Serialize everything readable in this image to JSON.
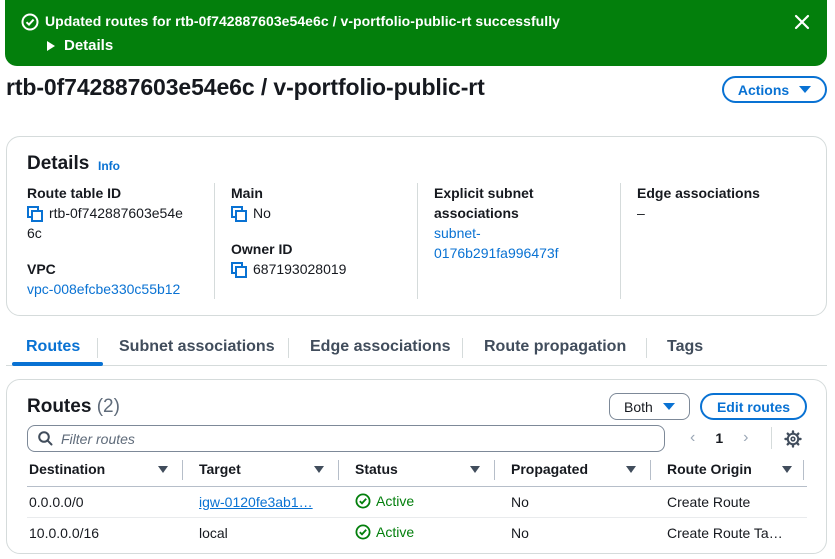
{
  "flash": {
    "message": "Updated routes for rtb-0f742887603e54e6c / v-portfolio-public-rt successfully",
    "details_label": "Details"
  },
  "header": {
    "title": "rtb-0f742887603e54e6c / v-portfolio-public-rt",
    "actions_label": "Actions"
  },
  "details": {
    "heading": "Details",
    "info_label": "Info",
    "route_table_id_label": "Route table ID",
    "route_table_id_line1": "rtb-0f742887603e54e",
    "route_table_id_line2": "6c",
    "vpc_label": "VPC",
    "vpc_value": "vpc-008efcbe330c55b12",
    "main_label": "Main",
    "main_value": "No",
    "owner_id_label": "Owner ID",
    "owner_id_value": "687193028019",
    "explicit_label_line1": "Explicit subnet",
    "explicit_label_line2": "associations",
    "explicit_value_line1": "subnet-",
    "explicit_value_line2": "0176b291fa996473f",
    "edge_label": "Edge associations",
    "edge_value": "–"
  },
  "tabs": [
    "Routes",
    "Subnet associations",
    "Edge associations",
    "Route propagation",
    "Tags"
  ],
  "routes": {
    "heading": "Routes",
    "count": "(2)",
    "filter_select": "Both",
    "edit_label": "Edit routes",
    "filter_placeholder": "Filter routes",
    "page": "1",
    "columns": [
      "Destination",
      "Target",
      "Status",
      "Propagated",
      "Route Origin"
    ],
    "rows": [
      {
        "destination": "0.0.0.0/0",
        "target": "igw-0120fe3ab1…",
        "status": "Active",
        "propagated": "No",
        "origin": "Create Route"
      },
      {
        "destination": "10.0.0.0/16",
        "target": "local",
        "status": "Active",
        "propagated": "No",
        "origin": "Create Route Ta…"
      }
    ]
  },
  "colors": {
    "success": "#037f0c",
    "link": "#0972d3"
  }
}
